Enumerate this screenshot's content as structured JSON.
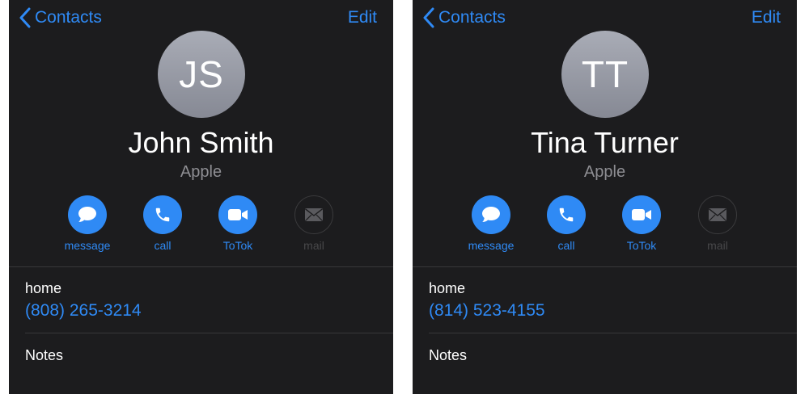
{
  "screens": [
    {
      "nav": {
        "back_label": "Contacts",
        "edit_label": "Edit"
      },
      "contact": {
        "initials": "JS",
        "name": "John Smith",
        "company": "Apple"
      },
      "actions": [
        {
          "label": "message",
          "icon": "message-icon",
          "enabled": true
        },
        {
          "label": "call",
          "icon": "phone-icon",
          "enabled": true
        },
        {
          "label": "ToTok",
          "icon": "video-icon",
          "enabled": true
        },
        {
          "label": "mail",
          "icon": "mail-icon",
          "enabled": false
        }
      ],
      "phone": {
        "label": "home",
        "number": "(808) 265-3214"
      },
      "notes_label": "Notes"
    },
    {
      "nav": {
        "back_label": "Contacts",
        "edit_label": "Edit"
      },
      "contact": {
        "initials": "TT",
        "name": "Tina Turner",
        "company": "Apple"
      },
      "actions": [
        {
          "label": "message",
          "icon": "message-icon",
          "enabled": true
        },
        {
          "label": "call",
          "icon": "phone-icon",
          "enabled": true
        },
        {
          "label": "ToTok",
          "icon": "video-icon",
          "enabled": true
        },
        {
          "label": "mail",
          "icon": "mail-icon",
          "enabled": false
        }
      ],
      "phone": {
        "label": "home",
        "number": "(814) 523-4155"
      },
      "notes_label": "Notes"
    }
  ],
  "colors": {
    "accent": "#2f8af5",
    "background": "#1c1c1e",
    "secondary_text": "#8e8e93",
    "disabled": "#48484a"
  }
}
